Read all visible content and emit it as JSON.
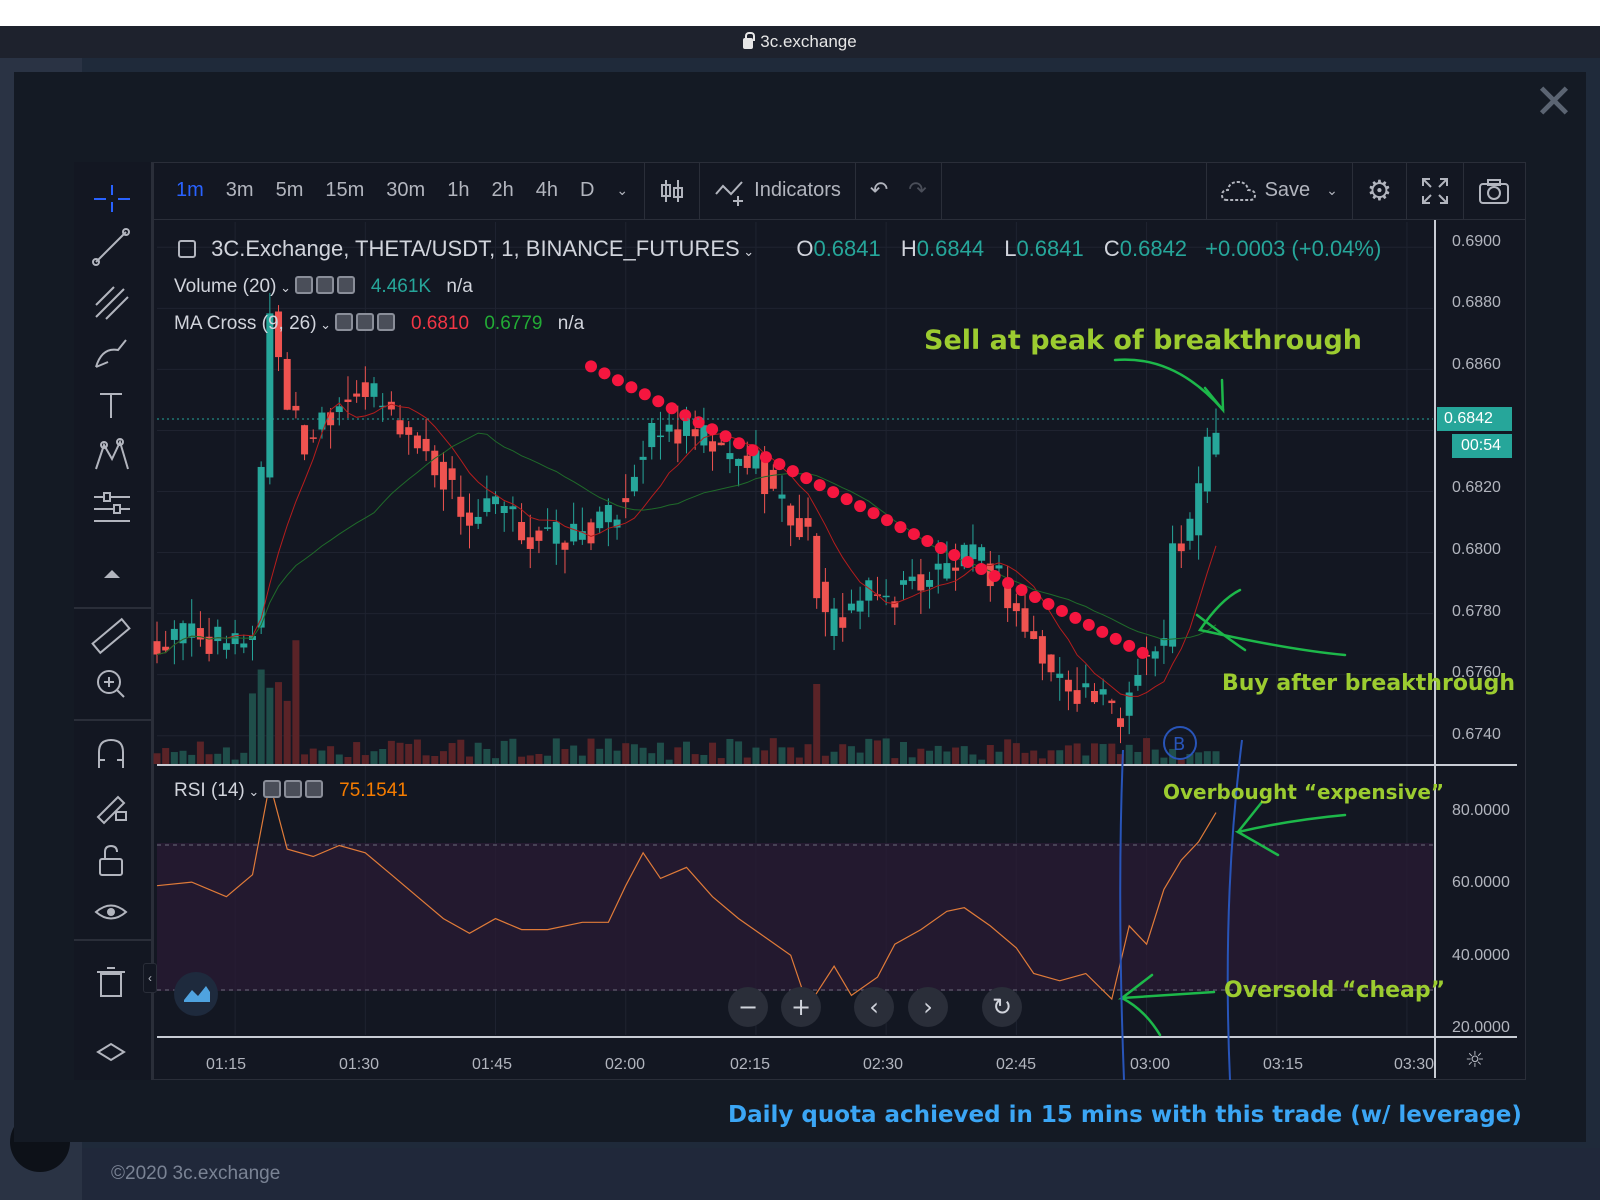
{
  "browser": {
    "url": "3c.exchange"
  },
  "footer": {
    "copyright": "©2020 3c.exchange"
  },
  "toolbar": {
    "timeframes": [
      "1m",
      "3m",
      "5m",
      "15m",
      "30m",
      "1h",
      "2h",
      "4h",
      "D"
    ],
    "active_timeframe": "1m",
    "indicators_label": "Indicators",
    "save_label": "Save"
  },
  "legend": {
    "symbol": "3C.Exchange, THETA/USDT, 1, BINANCE_FUTURES",
    "o_label": "O",
    "o": "0.6841",
    "h_label": "H",
    "h": "0.6844",
    "l_label": "L",
    "l": "0.6841",
    "c_label": "C",
    "c": "0.6842",
    "change": "+0.0003 (+0.04%)",
    "volume_label": "Volume (20)",
    "volume_value": "4.461K",
    "volume_na": "n/a",
    "ma_label": "MA Cross (9, 26)",
    "ma_fast": "0.6810",
    "ma_slow": "0.6779",
    "ma_na": "n/a",
    "rsi_label": "RSI (14)",
    "rsi_value": "75.1541"
  },
  "price_axis": {
    "ticks": [
      "0.6900",
      "0.6880",
      "0.6860",
      "0.6842",
      "0.6820",
      "0.6800",
      "0.6780",
      "0.6760",
      "0.6740"
    ],
    "current_price": "0.6842",
    "countdown": "00:54"
  },
  "rsi_axis": {
    "ticks": [
      "80.0000",
      "60.0000",
      "40.0000",
      "20.0000"
    ]
  },
  "time_axis": {
    "ticks": [
      "01:15",
      "01:30",
      "01:45",
      "02:00",
      "02:15",
      "02:30",
      "02:45",
      "03:00",
      "03:15",
      "03:30"
    ]
  },
  "annotations": {
    "sell": "Sell at peak of breakthrough",
    "buy": "Buy after breakthrough",
    "overbought": "Overbought “expensive”",
    "oversold": "Oversold “cheap”",
    "quota": "Daily quota achieved in 15 mins with this trade (w/ leverage)"
  },
  "colors": {
    "up": "#26a69a",
    "down": "#ef5350",
    "sar": "#f5163f",
    "annotation_green": "#9ccc30",
    "annotation_blue": "#3ba6f5",
    "rsi_line": "#e07b39"
  },
  "chart_data": {
    "type": "candlestick",
    "title": "3C.Exchange, THETA/USDT, 1, BINANCE_FUTURES",
    "xlabel": "",
    "ylabel": "",
    "x_range": [
      "01:06",
      "03:33"
    ],
    "ylim": [
      0.6735,
      0.6905
    ],
    "close_points": [
      [
        "01:06",
        0.6768
      ],
      [
        "01:10",
        0.6775
      ],
      [
        "01:14",
        0.6768
      ],
      [
        "01:17",
        0.6775
      ],
      [
        "01:19",
        0.688
      ],
      [
        "01:21",
        0.685
      ],
      [
        "01:23",
        0.6835
      ],
      [
        "01:25",
        0.6845
      ],
      [
        "01:29",
        0.6855
      ],
      [
        "01:33",
        0.6845
      ],
      [
        "01:36",
        0.6835
      ],
      [
        "01:39",
        0.6825
      ],
      [
        "01:42",
        0.681
      ],
      [
        "01:45",
        0.6815
      ],
      [
        "01:49",
        0.6805
      ],
      [
        "01:53",
        0.6805
      ],
      [
        "01:58",
        0.681
      ],
      [
        "02:00",
        0.682
      ],
      [
        "02:02",
        0.6835
      ],
      [
        "02:05",
        0.684
      ],
      [
        "02:08",
        0.6838
      ],
      [
        "02:12",
        0.683
      ],
      [
        "02:15",
        0.683
      ],
      [
        "02:18",
        0.6815
      ],
      [
        "02:21",
        0.6805
      ],
      [
        "02:23",
        0.6775
      ],
      [
        "02:27",
        0.6785
      ],
      [
        "02:30",
        0.6785
      ],
      [
        "02:33",
        0.679
      ],
      [
        "02:37",
        0.6795
      ],
      [
        "02:40",
        0.6798
      ],
      [
        "02:43",
        0.6792
      ],
      [
        "02:46",
        0.6775
      ],
      [
        "02:49",
        0.676
      ],
      [
        "02:53",
        0.6755
      ],
      [
        "02:57",
        0.6745
      ],
      [
        "02:59",
        0.6765
      ],
      [
        "03:02",
        0.677
      ],
      [
        "03:03",
        0.68
      ],
      [
        "03:05",
        0.6808
      ],
      [
        "03:06",
        0.682
      ],
      [
        "03:07",
        0.6835
      ],
      [
        "03:08",
        0.6842
      ]
    ],
    "rsi_points": [
      [
        "01:06",
        55
      ],
      [
        "01:10",
        56
      ],
      [
        "01:14",
        52
      ],
      [
        "01:17",
        58
      ],
      [
        "01:19",
        83
      ],
      [
        "01:21",
        65
      ],
      [
        "01:24",
        63
      ],
      [
        "01:27",
        66
      ],
      [
        "01:30",
        64
      ],
      [
        "01:33",
        58
      ],
      [
        "01:36",
        52
      ],
      [
        "01:39",
        46
      ],
      [
        "01:42",
        42
      ],
      [
        "01:45",
        46
      ],
      [
        "01:48",
        43
      ],
      [
        "01:51",
        43
      ],
      [
        "01:55",
        45
      ],
      [
        "01:58",
        45
      ],
      [
        "02:00",
        55
      ],
      [
        "02:02",
        64
      ],
      [
        "02:04",
        57
      ],
      [
        "02:07",
        60
      ],
      [
        "02:10",
        52
      ],
      [
        "02:13",
        46
      ],
      [
        "02:16",
        41
      ],
      [
        "02:19",
        36
      ],
      [
        "02:21",
        22
      ],
      [
        "02:24",
        33
      ],
      [
        "02:26",
        25
      ],
      [
        "02:29",
        30
      ],
      [
        "02:31",
        39
      ],
      [
        "02:34",
        43
      ],
      [
        "02:37",
        48
      ],
      [
        "02:39",
        49
      ],
      [
        "02:42",
        44
      ],
      [
        "02:45",
        38
      ],
      [
        "02:47",
        31
      ],
      [
        "02:50",
        29
      ],
      [
        "02:53",
        31
      ],
      [
        "02:56",
        24
      ],
      [
        "02:58",
        44
      ],
      [
        "03:00",
        39
      ],
      [
        "03:02",
        54
      ],
      [
        "03:04",
        62
      ],
      [
        "03:06",
        67
      ],
      [
        "03:08",
        75
      ]
    ]
  }
}
